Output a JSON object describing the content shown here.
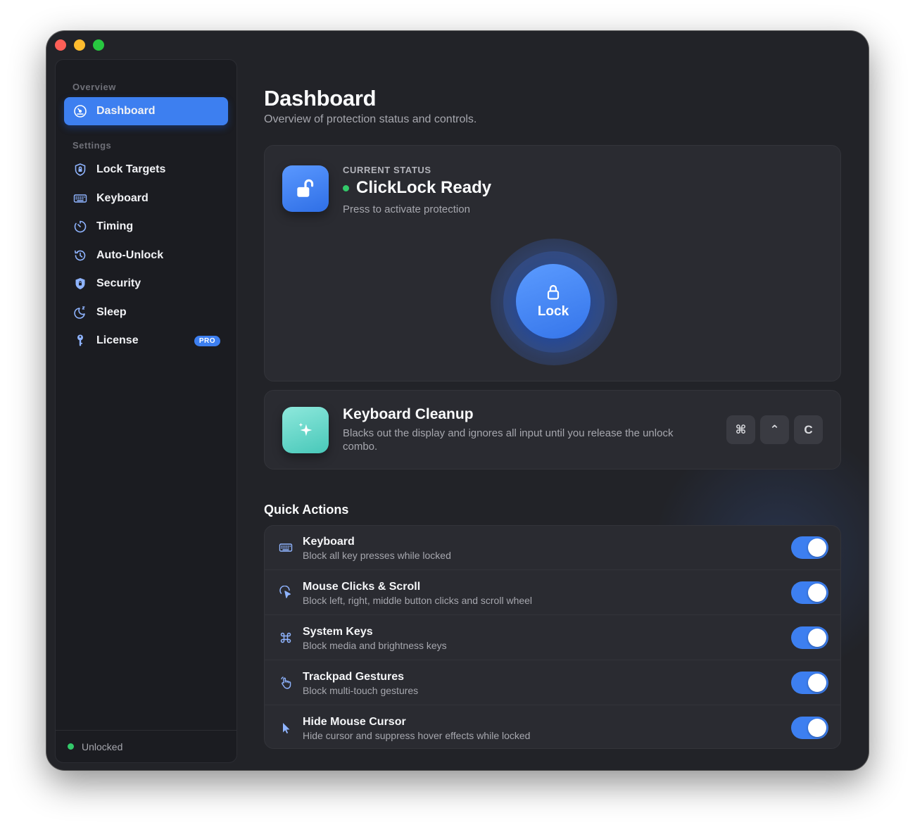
{
  "sidebar": {
    "overview_label": "Overview",
    "settings_label": "Settings",
    "items": [
      {
        "label": "Dashboard",
        "icon": "gauge-icon"
      },
      {
        "label": "Lock Targets",
        "icon": "shield-lock-icon"
      },
      {
        "label": "Keyboard",
        "icon": "keyboard-icon"
      },
      {
        "label": "Timing",
        "icon": "timer-icon"
      },
      {
        "label": "Auto-Unlock",
        "icon": "history-icon"
      },
      {
        "label": "Security",
        "icon": "shield-icon"
      },
      {
        "label": "Sleep",
        "icon": "moon-icon"
      },
      {
        "label": "License",
        "icon": "key-icon",
        "badge": "PRO"
      }
    ],
    "footer_status": "Unlocked"
  },
  "main": {
    "title": "Dashboard",
    "subtitle": "Overview of protection status and controls.",
    "status_card": {
      "label": "CURRENT STATUS",
      "title": "ClickLock Ready",
      "subtitle": "Press to activate protection",
      "lock_button": "Lock"
    },
    "keyboard_cleanup": {
      "title": "Keyboard Cleanup",
      "description": "Blacks out the display and ignores all input until you release the unlock combo.",
      "keys": [
        "⌘",
        "⌃",
        "C"
      ]
    },
    "quick_actions": {
      "title": "Quick Actions",
      "rows": [
        {
          "name": "Keyboard",
          "desc": "Block all key presses while locked",
          "icon": "keyboard-icon",
          "on": true
        },
        {
          "name": "Mouse Clicks & Scroll",
          "desc": "Block left, right, middle button clicks and scroll wheel",
          "icon": "cursor-click-icon",
          "on": true
        },
        {
          "name": "System Keys",
          "desc": "Block media and brightness keys",
          "icon": "command-icon",
          "on": true
        },
        {
          "name": "Trackpad Gestures",
          "desc": "Block multi-touch gestures",
          "icon": "hand-gesture-icon",
          "on": true
        },
        {
          "name": "Hide Mouse Cursor",
          "desc": "Hide cursor and suppress hover effects while locked",
          "icon": "cursor-arrow-icon",
          "on": true
        }
      ]
    }
  },
  "colors": {
    "accent": "#3d7ff0",
    "status_green": "#33c96a",
    "mint": "#5fd3c5",
    "window_bg": "#222328"
  }
}
